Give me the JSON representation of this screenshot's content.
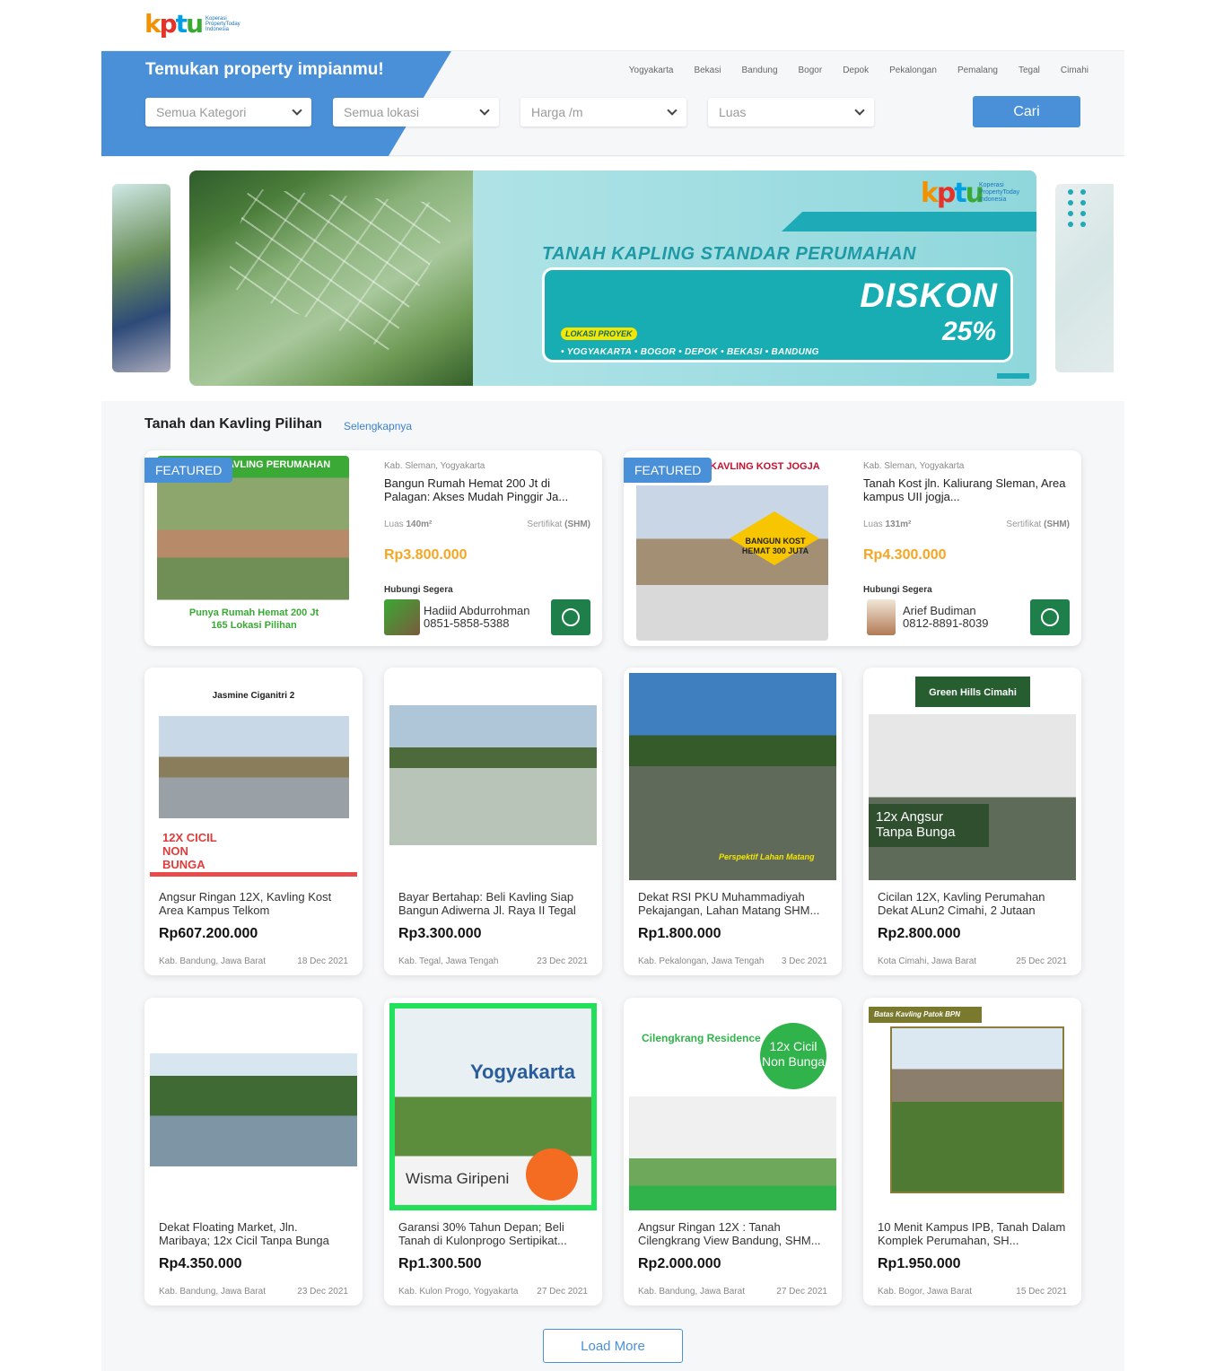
{
  "logo": {
    "mark": "kptu",
    "text": "Koperasi PropertyToday Indonesia"
  },
  "search": {
    "title": "Temukan property impianmu!",
    "cities": [
      "Yogyakarta",
      "Bekasi",
      "Bandung",
      "Bogor",
      "Depok",
      "Pekalongan",
      "Pemalang",
      "Tegal",
      "Cimahi"
    ],
    "category": "Semua Kategori",
    "location": "Semua lokasi",
    "price": "Harga /m",
    "area": "Luas",
    "submit": "Cari"
  },
  "banner": {
    "headline": "TANAH KAPLING STANDAR PERUMAHAN",
    "diskon": "DISKON",
    "percent": "25%",
    "lokasi_label": "LOKASI PROYEK",
    "cities": "• YOGYAKARTA   • BOGOR   • DEPOK   • BEKASI   • BANDUNG"
  },
  "section": {
    "title": "Tanah dan Kavling Pilihan",
    "link": "Selengkapnya"
  },
  "featured": [
    {
      "tag": "FEATURED",
      "thumb_caption_top": "KAVLING PERUMAHAN",
      "thumb_caption_bottom": "Punya Rumah Hemat 200 Jt\n165 Lokasi Pilihan",
      "location": "Kab. Sleman, Yogyakarta",
      "title": "Bangun Rumah Hemat 200 Jt di Palagan: Akses Mudah Pinggir Ja...",
      "luas_label": "Luas",
      "luas": "140m²",
      "sertifikat_label": "Sertifikat",
      "sertifikat": "(SHM)",
      "price": "Rp3.800.000",
      "contact_label": "Hubungi Segera",
      "contact_name": "Hadiid Abdurrohman",
      "contact_phone": "0851-5858-5388"
    },
    {
      "tag": "FEATURED",
      "thumb_caption_top": "KAVLING KOST JOGJA",
      "thumb_caption_bottom": "BANGUN KOST HEMAT 300 JUTA",
      "location": "Kab. Sleman, Yogyakarta",
      "title": "Tanah Kost jln. Kaliurang Sleman, Area kampus UII jogja...",
      "luas_label": "Luas",
      "luas": "131m²",
      "sertifikat_label": "Sertifikat",
      "sertifikat": "(SHM)",
      "price": "Rp4.300.000",
      "contact_label": "Hubungi Segera",
      "contact_name": "Arief Budiman",
      "contact_phone": "0812-8891-8039"
    }
  ],
  "listings": [
    {
      "title": "Angsur Ringan 12X, Kavling Kost Area Kampus Telkom",
      "price": "Rp607.200.000",
      "location": "Kab. Bandung, Jawa Barat",
      "date": "18 Dec 2021",
      "thumb_text": "Jasmine Ciganitri 2",
      "thumb_sub": "12X CICIL NON BUNGA"
    },
    {
      "title": "Bayar Bertahap: Beli Kavling Siap Bangun Adiwerna Jl. Raya II Tegal",
      "price": "Rp3.300.000",
      "location": "Kab. Tegal, Jawa Tengah",
      "date": "23 Dec 2021",
      "thumb_text": "",
      "thumb_sub": ""
    },
    {
      "title": "Dekat RSI PKU Muhammadiyah Pekajangan, Lahan Matang SHM...",
      "price": "Rp1.800.000",
      "location": "Kab. Pekalongan, Jawa Tengah",
      "date": "3 Dec 2021",
      "thumb_text": "Perspektif Lahan Matang",
      "thumb_sub": ""
    },
    {
      "title": "Cicilan 12X, Kavling Perumahan Dekat ALun2 Cimahi, 2 Jutaan",
      "price": "Rp2.800.000",
      "location": "Kota Cimahi, Jawa Barat",
      "date": "25 Dec 2021",
      "thumb_text": "Green Hills Cimahi",
      "thumb_sub": "12x Angsur Tanpa Bunga"
    },
    {
      "title": "Dekat Floating Market, Jln. Maribaya; 12x Cicil Tanpa Bunga",
      "price": "Rp4.350.000",
      "location": "Kab. Bandung, Jawa Barat",
      "date": "23 Dec 2021",
      "thumb_text": "",
      "thumb_sub": ""
    },
    {
      "title": "Garansi 30% Tahun Depan; Beli Tanah di Kulonprogo Sertipikat...",
      "price": "Rp1.300.500",
      "location": "Kab. Kulon Progo, Yogyakarta",
      "date": "27 Dec 2021",
      "thumb_text": "Yogyakarta",
      "thumb_sub": "Wisma Giripeni"
    },
    {
      "title": "Angsur Ringan 12X : Tanah Cilengkrang View Bandung, SHM...",
      "price": "Rp2.000.000",
      "location": "Kab. Bandung, Jawa Barat",
      "date": "27 Dec 2021",
      "thumb_text": "Cilengkrang Residence",
      "thumb_sub": "12x Cicil Non Bunga"
    },
    {
      "title": "10 Menit Kampus IPB, Tanah Dalam Komplek Perumahan, SH...",
      "price": "Rp1.950.000",
      "location": "Kab. Bogor, Jawa Barat",
      "date": "15 Dec 2021",
      "thumb_text": "Batas Kavling Patok BPN",
      "thumb_sub": ""
    }
  ],
  "load_more": "Load More",
  "colors": {
    "primary": "#4a90d9",
    "price_featured": "#f5a623",
    "whatsapp": "#1e7f4b"
  }
}
